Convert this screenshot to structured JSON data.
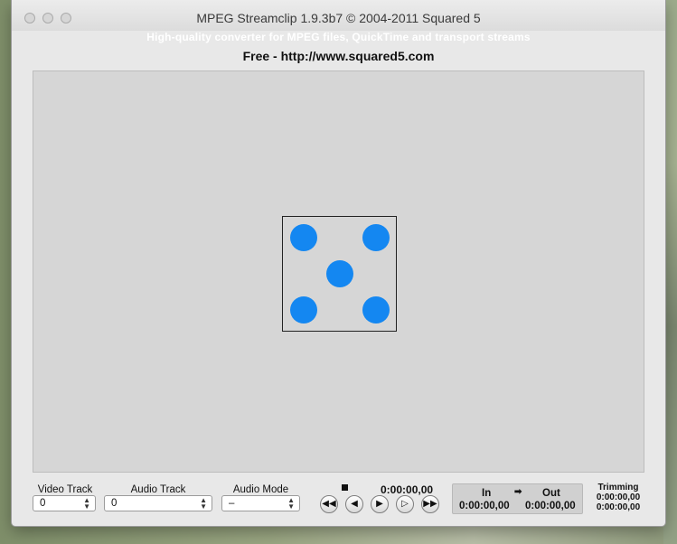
{
  "window": {
    "title": "MPEG Streamclip 1.9.3b7  ©  2004-2011 Squared 5",
    "subtitle": "High-quality converter for MPEG files, QuickTime and transport streams",
    "free_line": "Free  -  http://www.squared5.com"
  },
  "controls": {
    "video_track": {
      "label": "Video Track",
      "value": "0"
    },
    "audio_track": {
      "label": "Audio Track",
      "value": "0"
    },
    "audio_mode": {
      "label": "Audio Mode",
      "value": "–"
    },
    "timecode": "0:00:00,00",
    "transport_icons": [
      "rewind-icon",
      "step-back-icon",
      "play-icon",
      "step-forward-icon",
      "fast-forward-icon"
    ],
    "in_label": "In",
    "arrow": "➡",
    "out_label": "Out",
    "in_value": "0:00:00,00",
    "out_value": "0:00:00,00",
    "trimming_label": "Trimming",
    "trimming_value_1": "0:00:00,00",
    "trimming_value_2": "0:00:00,00"
  },
  "colors": {
    "logo_dot": "#1487f1",
    "window_bg": "#e8e8e8",
    "video_area_bg": "#d6d6d6"
  }
}
